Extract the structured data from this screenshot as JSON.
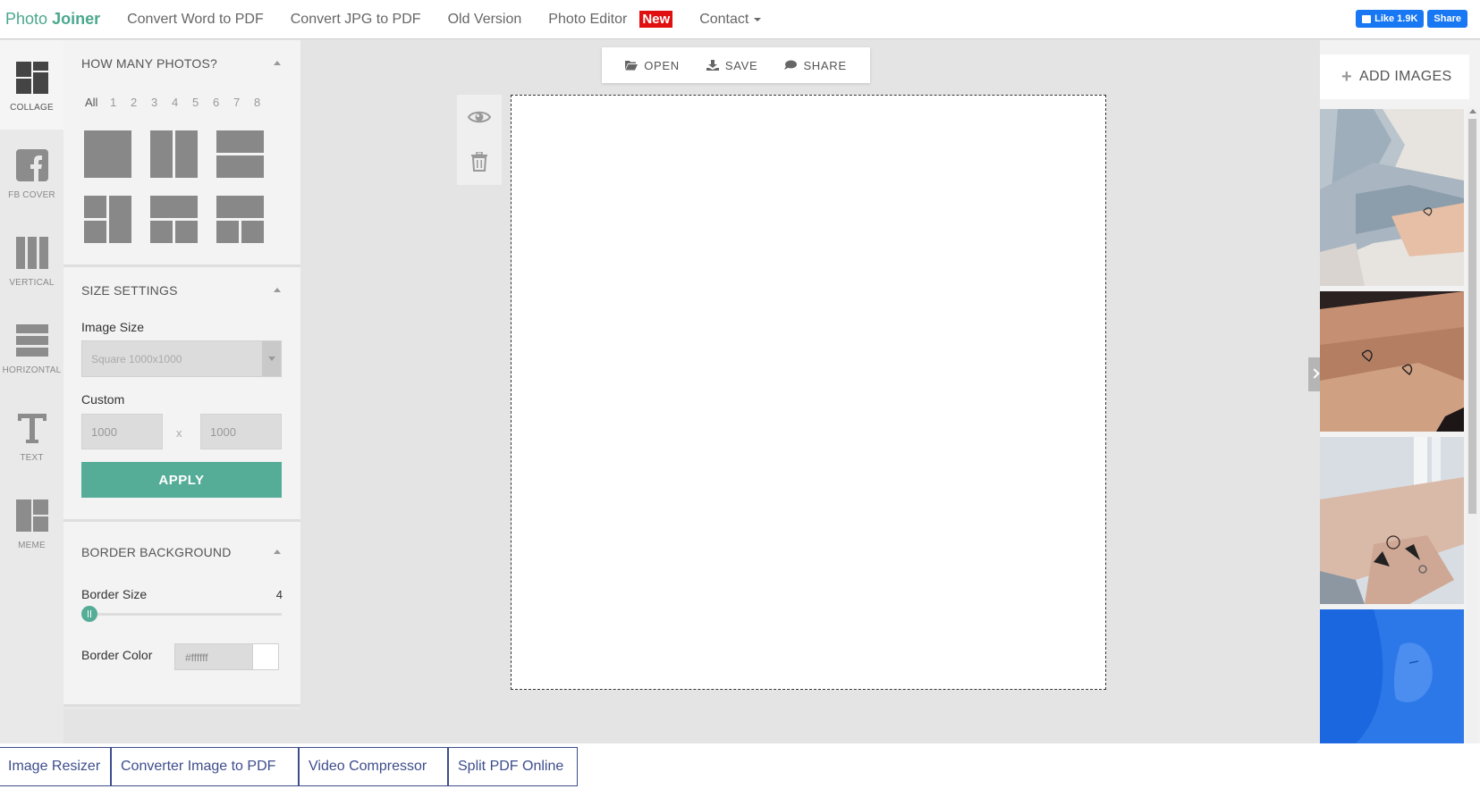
{
  "nav": {
    "brand_a": "Photo",
    "brand_b": "Joiner",
    "links": [
      "Convert Word to PDF",
      "Convert JPG to PDF",
      "Old Version",
      "Photo Editor"
    ],
    "new_badge": "New",
    "contact": "Contact",
    "fb_like": "Like 1.9K",
    "fb_share": "Share"
  },
  "rail": {
    "items": [
      "COLLAGE",
      "FB COVER",
      "VERTICAL",
      "HORIZONTAL",
      "TEXT",
      "MEME"
    ]
  },
  "panel": {
    "how_many_title": "HOW MANY PHOTOS?",
    "counts": [
      "All",
      "1",
      "2",
      "3",
      "4",
      "5",
      "6",
      "7",
      "8"
    ],
    "size_title": "SIZE SETTINGS",
    "image_size_label": "Image Size",
    "image_size_value": "Square 1000x1000",
    "custom_label": "Custom",
    "custom_width": "1000",
    "custom_sep": "x",
    "custom_height": "1000",
    "apply_label": "APPLY",
    "border_title": "BORDER BACKGROUND",
    "border_size_label": "Border Size",
    "border_size_value": "4",
    "border_color_label": "Border Color",
    "border_color_value": "#ffffff"
  },
  "toolbar": {
    "open": "OPEN",
    "save": "SAVE",
    "share": "SHARE"
  },
  "images": {
    "add_label": "ADD IMAGES"
  },
  "bottom_links": [
    "Image Resizer",
    "Converter Image to PDF",
    "Video Compressor",
    "Split PDF Online"
  ],
  "colors": {
    "accent": "#55ac97",
    "brand": "#4aa88e",
    "bottom_link": "#3d4d8c",
    "new_badge": "#e01010"
  }
}
